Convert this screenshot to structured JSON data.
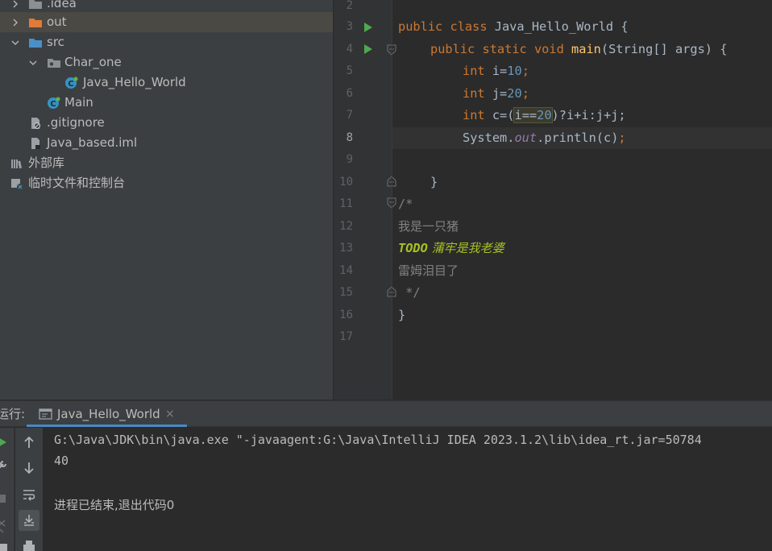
{
  "project_tree": {
    "items": [
      {
        "label": ".idea",
        "icon": "folder-icon"
      },
      {
        "label": "out",
        "icon": "folder-orange-icon"
      },
      {
        "label": "src",
        "icon": "folder-blue-icon"
      },
      {
        "label": "Char_one",
        "icon": "package-icon"
      },
      {
        "label": "Java_Hello_World",
        "icon": "java-class-icon"
      },
      {
        "label": "Main",
        "icon": "java-class-icon"
      },
      {
        "label": ".gitignore",
        "icon": "gitignore-file-icon"
      },
      {
        "label": "Java_based.iml",
        "icon": "iml-file-icon"
      },
      {
        "label": "外部库",
        "icon": "library-icon"
      },
      {
        "label": "临时文件和控制台",
        "icon": "scratch-icon"
      }
    ]
  },
  "editor": {
    "line_numbers": [
      "2",
      "3",
      "4",
      "5",
      "6",
      "7",
      "8",
      "9",
      "10",
      "11",
      "12",
      "13",
      "14",
      "15",
      "16",
      "17"
    ],
    "current_line": "8",
    "code": {
      "l3": {
        "kw1": "public",
        "kw2": "class",
        "name": "Java_Hello_World",
        "brace": " {"
      },
      "l4": {
        "kw1": "public",
        "kw2": "static",
        "kw3": "void",
        "fn": "main",
        "rest": "(String[] args) {"
      },
      "l5": {
        "kw": "int",
        "var": " i=",
        "num": "10",
        "end": ";"
      },
      "l6": {
        "kw": "int",
        "var": " j=",
        "num": "20",
        "end": ";"
      },
      "l7": {
        "kw": "int",
        "pre": " c=(",
        "hl1": "i==",
        "hl2": "20",
        "rest": ")?i+i:j+j;"
      },
      "l8": {
        "pre": "System.",
        "fld": "out",
        "rest": ".println(c)",
        "end": ";"
      },
      "l10": "}",
      "l11": "/*",
      "l12": "我是一只猪",
      "l13": {
        "todo": "TODO",
        "text": " 蒲牢是我老婆"
      },
      "l14": "雷姆泪目了",
      "l15": " */",
      "l16": "}"
    }
  },
  "run_panel": {
    "label": "运行:",
    "tab_title": "Java_Hello_World",
    "tab_close": "×",
    "console_lines": [
      "G:\\Java\\JDK\\bin\\java.exe \"-javaagent:G:\\Java\\IntelliJ IDEA 2023.1.2\\lib\\idea_rt.jar=50784",
      "40",
      "",
      "进程已结束,退出代码0"
    ],
    "tools": [
      "arrow-up-icon",
      "arrow-down-icon",
      "soft-wrap-icon",
      "scroll-to-end-icon",
      "print-icon"
    ]
  },
  "colors": {
    "keyword": "#cc7832",
    "number": "#6897bb",
    "method": "#ffc66d",
    "field": "#9876aa",
    "todo": "#a8c023",
    "comment": "#808080",
    "tab_underline": "#4a88c7"
  }
}
